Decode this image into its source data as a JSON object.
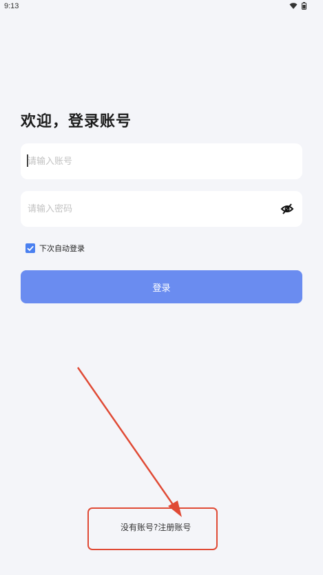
{
  "status_bar": {
    "time": "9:13",
    "icons": [
      "wifi-icon",
      "battery-icon"
    ]
  },
  "login": {
    "title": "欢迎，登录账号",
    "account_placeholder": "请输入账号",
    "account_value": "",
    "password_placeholder": "请输入密码",
    "password_value": "",
    "password_toggle_icon": "eye-off-icon",
    "remember_label": "下次自动登录",
    "remember_checked": true,
    "login_button_label": "登录",
    "register_link": "没有账号?注册账号"
  },
  "colors": {
    "background": "#f4f5f9",
    "primary_button": "#6a8cf0",
    "checkbox": "#4a80f0",
    "annotation": "#e04a35"
  }
}
